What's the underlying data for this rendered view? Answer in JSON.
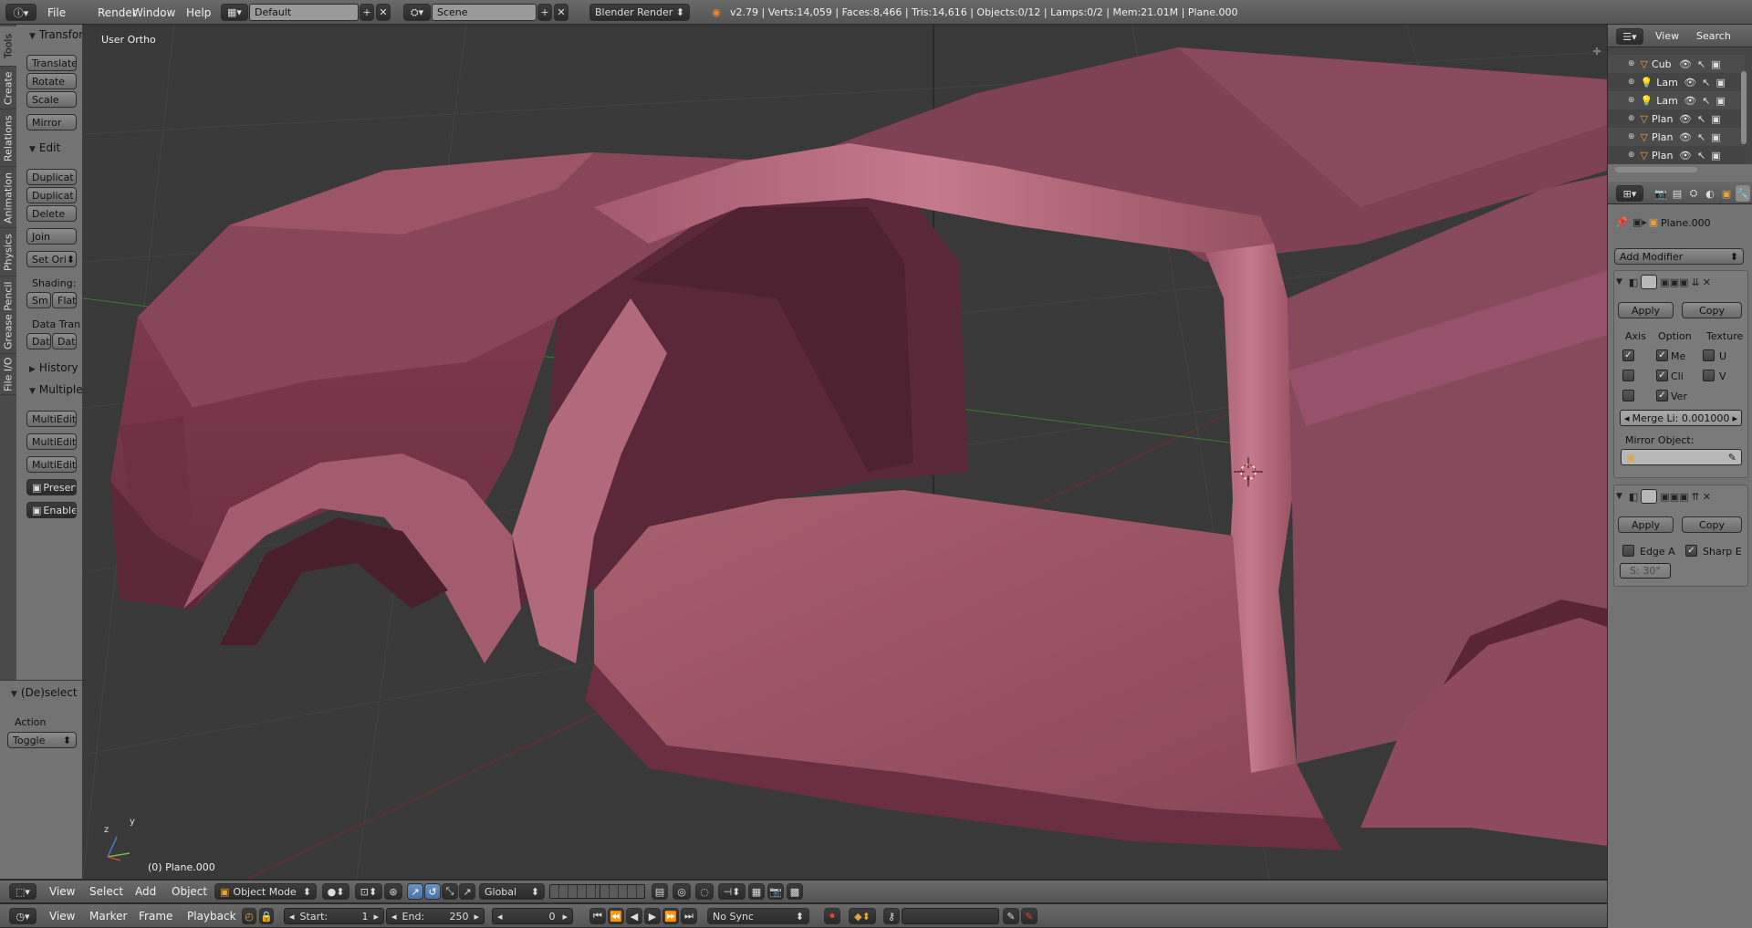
{
  "top_bar": {
    "menus": [
      "File",
      "Render",
      "Window",
      "Help"
    ],
    "screen_layout": "Default",
    "scene": "Scene",
    "engine": "Blender Render",
    "stats": "v2.79 | Verts:14,059 | Faces:8,466 | Tris:14,616 | Objects:0/12 | Lamps:0/2 | Mem:21.01M | Plane.000"
  },
  "tool_shelf": {
    "tabs": [
      "Tools",
      "Create",
      "Relations",
      "Animation",
      "Physics",
      "Grease Pencil",
      "File I/O"
    ],
    "transform_header": "Transfor",
    "transform_buttons": [
      "Translate",
      "Rotate",
      "Scale"
    ],
    "mirror": "Mirror",
    "edit_header": "Edit",
    "edit_buttons": [
      "Duplicat",
      "Duplicat",
      "Delete"
    ],
    "join": "Join",
    "set_origin": "Set Ori",
    "shading_label": "Shading:",
    "shading_buttons": [
      "Sm",
      "Flat"
    ],
    "data_transfer_label": "Data Tran",
    "data_buttons": [
      "Dat",
      "Dat"
    ],
    "history_header": "History",
    "multiedit_header": "Multiple",
    "multiedit_buttons": [
      "MultiEdit",
      "MultiEdit",
      "MultiEdit"
    ],
    "preserve": "Preserv",
    "enable": "Enable",
    "operator_header": "(De)select",
    "action_label": "Action",
    "action_value": "Toggle"
  },
  "viewport": {
    "view_name": "User Ortho",
    "object_info": "(0) Plane.000",
    "axis_y": "y",
    "axis_z": "z"
  },
  "viewport_header": {
    "menus": [
      "View",
      "Select",
      "Add",
      "Object"
    ],
    "mode": "Object Mode",
    "orientation": "Global"
  },
  "timeline": {
    "menus": [
      "View",
      "Marker",
      "Frame",
      "Playback"
    ],
    "start_label": "Start:",
    "start_value": "1",
    "end_label": "End:",
    "end_value": "250",
    "current_frame": "0",
    "sync": "No Sync"
  },
  "outliner": {
    "menus": [
      "View",
      "Search"
    ],
    "items": [
      {
        "name": "Cub",
        "type": "mesh"
      },
      {
        "name": "Lam",
        "type": "lamp"
      },
      {
        "name": "Lam",
        "type": "lamp"
      },
      {
        "name": "Plan",
        "type": "mesh"
      },
      {
        "name": "Plan",
        "type": "mesh"
      },
      {
        "name": "Plan",
        "type": "mesh"
      }
    ]
  },
  "properties": {
    "object_name": "Plane.000",
    "add_modifier": "Add Modifier",
    "mirror_mod": {
      "apply": "Apply",
      "copy": "Copy",
      "col_headers": [
        "Axis",
        "Option",
        "Texture"
      ],
      "rows": [
        {
          "axis": true,
          "opt_label": "Me",
          "opt": true,
          "tex_label": "U",
          "tex": false
        },
        {
          "axis": false,
          "opt_label": "Cli",
          "opt": true,
          "tex_label": "V",
          "tex": false
        },
        {
          "axis": false,
          "opt_label": "Ver",
          "opt": true
        }
      ],
      "merge_limit": "Merge Li: 0.001000",
      "mirror_object_label": "Mirror Object:"
    },
    "edge_split_mod": {
      "apply": "Apply",
      "copy": "Copy",
      "edge_angle_label": "Edge A",
      "edge_angle": false,
      "sharp_edges_label": "Sharp E",
      "sharp_edges": true,
      "angle_value": "S: 30°"
    }
  },
  "colors": {
    "truck": "#8e4a5c",
    "viewport_bg": "#393939",
    "panel": "#737373"
  }
}
